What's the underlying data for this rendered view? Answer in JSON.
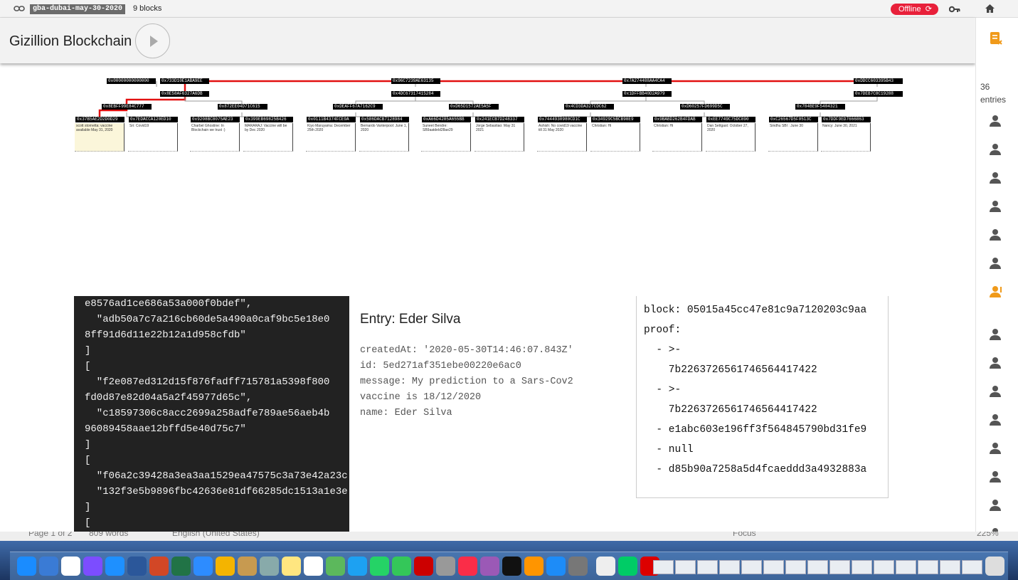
{
  "topbar": {
    "room": "gba-dubai-may-30-2020",
    "blocks": "9 blocks",
    "status": "Offline",
    "refresh_glyph": "⟳",
    "icons": [
      "link-icon",
      "key-icon",
      "home-icon"
    ]
  },
  "header": {
    "title": "Gizillion Blockchain",
    "play_icon": "play-icon"
  },
  "sidebar": {
    "count": "36",
    "count_label": "entries",
    "icon": "notes-icon",
    "alert_color": "#f09a1a"
  },
  "chain": {
    "row1": [
      "0x00000000000000",
      "0x733D10E1ABA9EE",
      "0x96C7239AE63135",
      "0x7A274488AA4CA4",
      "0xDDCC603395B43"
    ],
    "row2": [
      "0x8E58AF6327A6DB",
      "0x4DC67317415284",
      "0x1DFFBB40D2A979",
      "0x7DEB7C8C19288"
    ],
    "row3": [
      "0x8EBFF99E84C777",
      "0x872EE04D71C615",
      "0xDEAFF67A7162C9",
      "0xD65D1572AE5A5F",
      "0x4CD3DA327CDC62",
      "0xD60257FD699D5C",
      "0x784BE9F5404321"
    ],
    "row4": [
      "0x37B5AE2D2D0D29",
      "0x7EDACCA120ED10",
      "0x9208BC8075AE23",
      "0x399EB69825B426",
      "0x0111B4374FCE9A",
      "0x586DACB7128984",
      "0xA66D4285A655BB",
      "0x241ECB7D248337",
      "0x7444930980CD1C",
      "0x34929C5BCB98E9",
      "0x9BABD262B4FDAB",
      "0xEE7749C75DC890",
      "0xC26567D5F0513C",
      "0x7DDF9ED7666863"
    ],
    "cards": [
      "scott stornetta: vaccine available May 31, 2020",
      "Sri: Covid19",
      "Charbel Ghostine: In Blockchain we trust :)",
      "MARARAJ: Vaccine will be by Dec 2020",
      "Kiyo Maruyama: December 25th 2020",
      "Bernardo Vanterpool: June 1, 2020",
      "Suneet Bendre: SB9aatdeld28ae29",
      "Jorge Sebastiao: May 31 2021",
      "Ashish: No covid19 vaccine till 31 May 2020",
      "Christian: Hi",
      "Christian: Hi",
      "Dan Settgast: October 27, 2020",
      "Sindhu SBI : June 30",
      "Nancy: June 30, 2021"
    ]
  },
  "code": {
    "lines": [
      "e8576ad1ce686a53a000f0bdef\",",
      "  \"adb50a7c7a216cb60de5a490a0caf9bc5e18e0",
      "8ff91d6d11e22b12a1d958cfdb\"",
      "]",
      "[",
      "  \"f2e087ed312d15f876fadff715781a5398f800",
      "fd0d87e82d04a5a2f45977d65c\",",
      "  \"c18597306c8acc2699a258adfe789ae56aeb4b",
      "96089458aae12bffd5e40d75c7\"",
      "]",
      "[",
      "  \"f06a2c39428a3ea3aa1529ea47575c3a73e42a23c",
      "  \"132f3e5b9896fbc42636e81df66285dc1513a1e3e",
      "]",
      "["
    ]
  },
  "entry": {
    "title": "Entry: Eder Silva",
    "createdAt": "createdAt: '2020-05-30T14:46:07.843Z'",
    "id": "id: 5ed271af351ebe00220e6ac0",
    "message": "message: My prediction to a Sars-Cov2 vaccine is 18/12/2020",
    "name": "name: Eder Silva"
  },
  "proof": {
    "lines": [
      "block: 05015a45cc47e81c9a7120203c9aa",
      "proof:",
      "  - >-",
      "    7b2263726561746564417422",
      "  - >-",
      "    7b2263726561746564417422",
      "  - e1abc603e196ff3f564845790bd31fe9",
      "  - null",
      "  - d85b90a7258a5d4fcaeddd3a4932883a"
    ]
  },
  "word_status": {
    "page": "Page 1 of 2",
    "words": "809 words",
    "lang": "English (United States)",
    "focus": "Focus",
    "zoom": "225%"
  }
}
